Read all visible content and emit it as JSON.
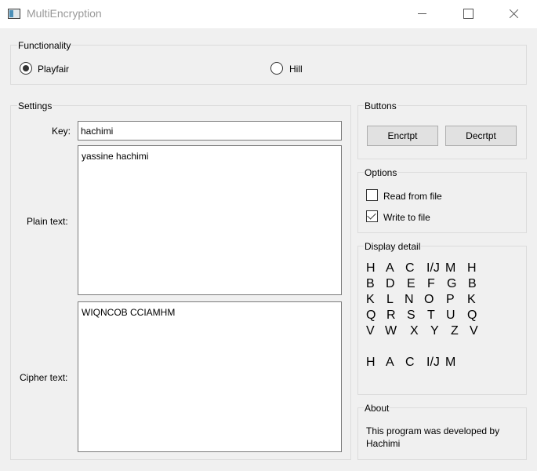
{
  "window": {
    "title": "MultiEncryption",
    "icon": "app-window-icon"
  },
  "functionality": {
    "title": "Functionality",
    "options": [
      {
        "label": "Playfair",
        "checked": true
      },
      {
        "label": "Hill",
        "checked": false
      }
    ]
  },
  "settings": {
    "title": "Settings",
    "key_label": "Key:",
    "key_value": "hachimi",
    "plain_label": "Plain text:",
    "plain_value": "yassine hachimi",
    "cipher_label": "Cipher text:",
    "cipher_value": "WIQNCOB CCIAMHM"
  },
  "buttons": {
    "title": "Buttons",
    "encrypt_label": "Encrtpt",
    "decrypt_label": "Decrtpt"
  },
  "options": {
    "title": "Options",
    "items": [
      {
        "label": "Read from file",
        "checked": false
      },
      {
        "label": "Write to file",
        "checked": true
      }
    ]
  },
  "display": {
    "title": "Display detail",
    "matrix": [
      [
        "H",
        "A",
        "C",
        "I/J",
        "M",
        "H"
      ],
      [
        "B",
        "D",
        "E",
        "F",
        "G",
        "B"
      ],
      [
        "K",
        "L",
        "N",
        "O",
        "P",
        "K"
      ],
      [
        "Q",
        "R",
        "S",
        "T",
        "U",
        "Q"
      ],
      [
        "V",
        "W",
        "X",
        "Y",
        "Z",
        "V"
      ],
      [
        "H",
        "A",
        "C",
        "I/J",
        "M"
      ]
    ]
  },
  "about": {
    "title": "About",
    "text": "This program was developed by Hachimi"
  }
}
